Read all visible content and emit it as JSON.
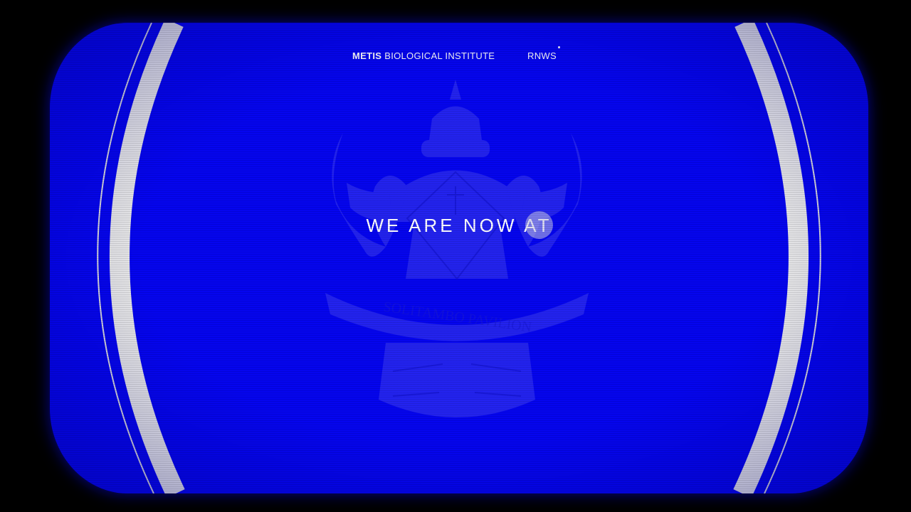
{
  "nav": {
    "brand_strong": "METIS",
    "brand_rest": "BIOLOGICAL INSTITUTE",
    "news_label": "RNWS"
  },
  "hero": {
    "headline": "WE ARE NOW AT"
  },
  "emblem": {
    "banner_text": "SOLITAMBO PAVILION",
    "icon": "winged-crest-emblem"
  },
  "colors": {
    "screen_blue": "#0505ef",
    "emblem_tint": "#3c3cf0",
    "frame_black": "#000000",
    "arc_white": "#e8e8e8"
  }
}
